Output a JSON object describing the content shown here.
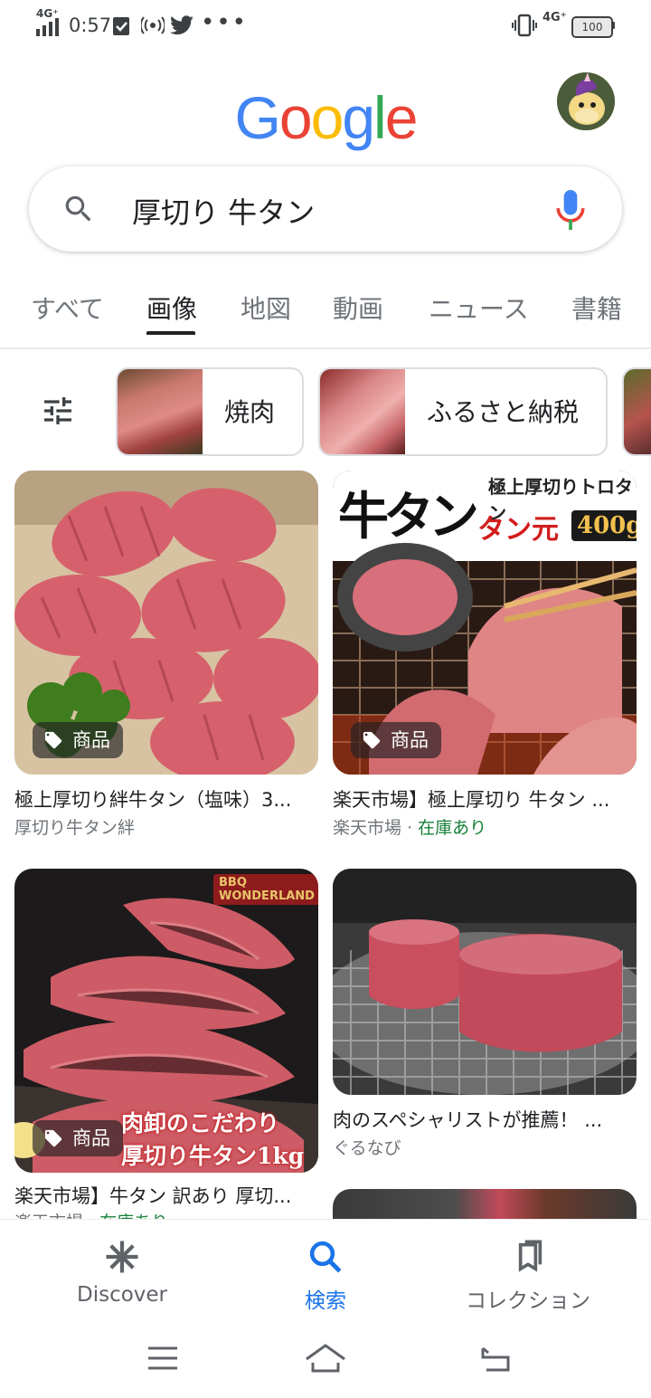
{
  "status_bar": {
    "network_left": "4G⁺",
    "time": "0:57",
    "network_right": "4G⁺",
    "battery": "100"
  },
  "logo": "Google",
  "search": {
    "query": "厚切り 牛タン"
  },
  "tabs": [
    "すべて",
    "画像",
    "地図",
    "動画",
    "ニュース",
    "書籍"
  ],
  "active_tab": "画像",
  "chips": [
    {
      "label": "焼肉"
    },
    {
      "label": "ふるさと納税"
    }
  ],
  "results": [
    {
      "title": "極上厚切り絆牛タン（塩味）3...",
      "source": "厚切り牛タン絆",
      "badge": "商品"
    },
    {
      "title": "楽天市場】極上厚切り 牛タン ...",
      "source": "楽天市場",
      "stock": "在庫あり",
      "badge": "商品",
      "overlay": {
        "line1": "極上厚切りトロタン",
        "line2": "牛タン",
        "line3": "タン元",
        "weight": "400g"
      }
    },
    {
      "title": "楽天市場】牛タン 訳あり 厚切...",
      "source": "楽天市場",
      "stock": "在庫あり",
      "badge": "商品",
      "overlay": {
        "brand": "BBQ WONDERLAND",
        "line1": "肉卸のこだわり",
        "line2": "厚切り牛タン1kg"
      }
    },
    {
      "title": "肉のスペシャリストが推薦！ ...",
      "source": "ぐるなび"
    }
  ],
  "source_separator": "·",
  "bottom_nav": [
    {
      "label": "Discover",
      "icon": "asterisk-icon"
    },
    {
      "label": "検索",
      "icon": "search-icon"
    },
    {
      "label": "コレクション",
      "icon": "bookmarks-icon"
    }
  ],
  "colors": {
    "accent": "#1a73e8",
    "in_stock": "#188038",
    "meat": "#d9626c"
  }
}
